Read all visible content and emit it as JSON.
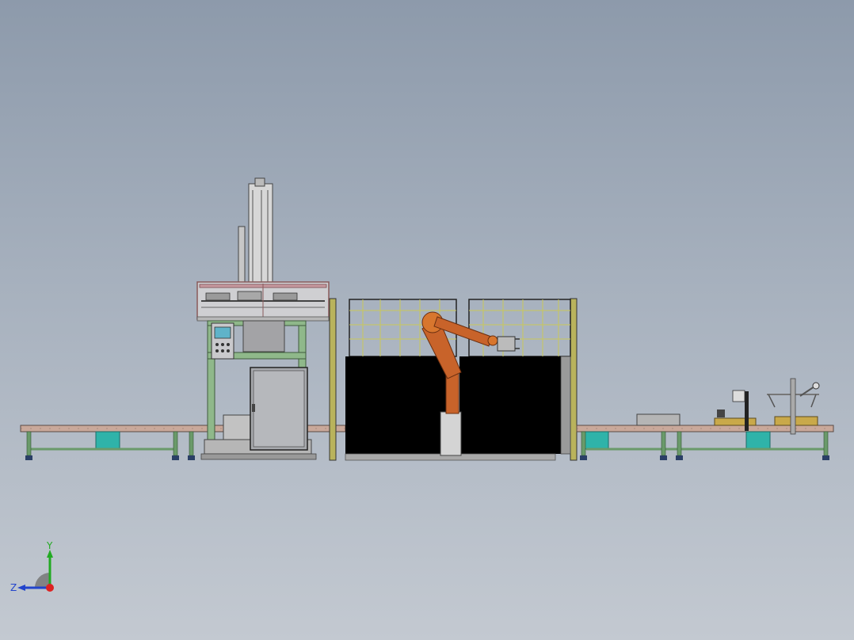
{
  "viewport": {
    "background_top": "#8d9aab",
    "background_bottom": "#c3c9d1"
  },
  "scene": {
    "components": [
      "infeed-conveyor",
      "feeder-gantry-station",
      "control-panel",
      "electrical-cabinet",
      "robot-cell-guard",
      "industrial-robot-arm",
      "outfeed-conveyor",
      "end-station-fixtures"
    ],
    "colors": {
      "conveyor_top": "#c9a89a",
      "conveyor_legs": "#6a9a6a",
      "conveyor_box": "#2fb3a9",
      "frame_green": "#8fb88a",
      "guard_fill": "#000000",
      "guard_mesh": "#c9c85a",
      "robot_orange": "#c8632a",
      "gantry_pink": "#c79aa0"
    }
  },
  "triad": {
    "y_label": "Y",
    "z_label": "Z",
    "y_color": "#22aa22",
    "z_color": "#2244cc",
    "origin_color": "#dd2222"
  }
}
